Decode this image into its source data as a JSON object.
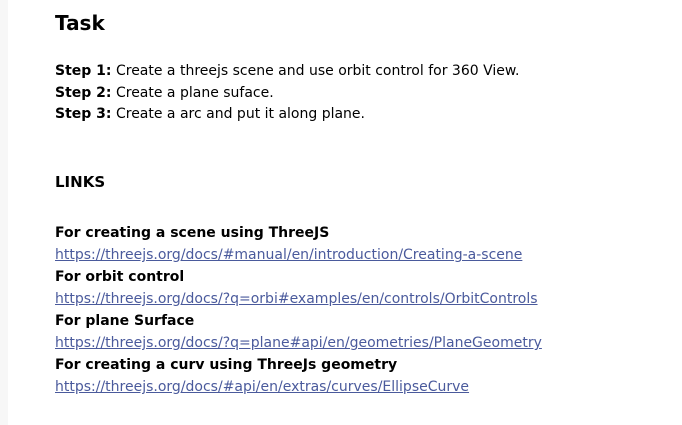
{
  "task": {
    "title": "Task",
    "steps": [
      {
        "label": "Step 1:",
        "text": " Create a threejs scene and use orbit control for 360 View."
      },
      {
        "label": "Step 2:",
        "text": " Create a plane suface."
      },
      {
        "label": "Step 3:",
        "text": " Create a arc and put it along plane."
      }
    ]
  },
  "links": {
    "title": "LINKS",
    "items": [
      {
        "heading": "For creating a scene using ThreeJS",
        "url": "https://threejs.org/docs/#manual/en/introduction/Creating-a-scene"
      },
      {
        "heading": "For orbit control",
        "url": "https://threejs.org/docs/?q=orbi#examples/en/controls/OrbitControls"
      },
      {
        "heading": "For plane Surface",
        "url": "https://threejs.org/docs/?q=plane#api/en/geometries/PlaneGeometry"
      },
      {
        "heading": "For creating a curv using ThreeJs geometry",
        "url": "https://threejs.org/docs/#api/en/extras/curves/EllipseCurve"
      }
    ]
  },
  "colors": {
    "link": "#4a5a9c",
    "text": "#000000",
    "background": "#ffffff"
  }
}
